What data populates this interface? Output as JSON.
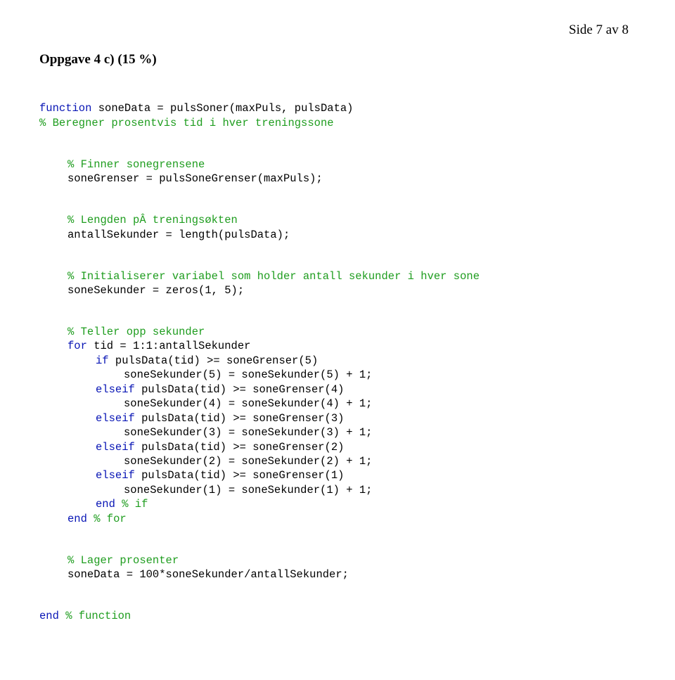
{
  "pageLabel": "Side 7 av 8",
  "heading": "Oppgave 4 c) (15 %)",
  "code": {
    "l1a": "function",
    "l1b": " soneData = pulsSoner(maxPuls, pulsData)",
    "l2": "% Beregner prosentvis tid i hver treningssone",
    "l3": "% Finner sonegrensene",
    "l4": "soneGrenser = pulsSoneGrenser(maxPuls);",
    "l5": "% Lengden pÂ treningsøkten",
    "l6": "antallSekunder = length(pulsData);",
    "l7": "% Initialiserer variabel som holder antall sekunder i hver sone",
    "l8": "soneSekunder = zeros(1, 5);",
    "l9": "% Teller opp sekunder",
    "l10a": "for",
    "l10b": " tid = 1:1:antallSekunder",
    "l11a": "if",
    "l11b": " pulsData(tid) >= soneGrenser(5)",
    "l12": "soneSekunder(5) = soneSekunder(5) + 1;",
    "l13a": "elseif",
    "l13b": " pulsData(tid) >= soneGrenser(4)",
    "l14": "soneSekunder(4) = soneSekunder(4) + 1;",
    "l15a": "elseif",
    "l15b": " pulsData(tid) >= soneGrenser(3)",
    "l16": "soneSekunder(3) = soneSekunder(3) + 1;",
    "l17a": "elseif",
    "l17b": " pulsData(tid) >= soneGrenser(2)",
    "l18": "soneSekunder(2) = soneSekunder(2) + 1;",
    "l19a": "elseif",
    "l19b": " pulsData(tid) >= soneGrenser(1)",
    "l20": "soneSekunder(1) = soneSekunder(1) + 1;",
    "l21a": "end",
    "l21b": " % if",
    "l22a": "end",
    "l22b": " % for",
    "l23": "% Lager prosenter",
    "l24": "soneData = 100*soneSekunder/antallSekunder;",
    "l25a": "end",
    "l25b": " % function"
  }
}
